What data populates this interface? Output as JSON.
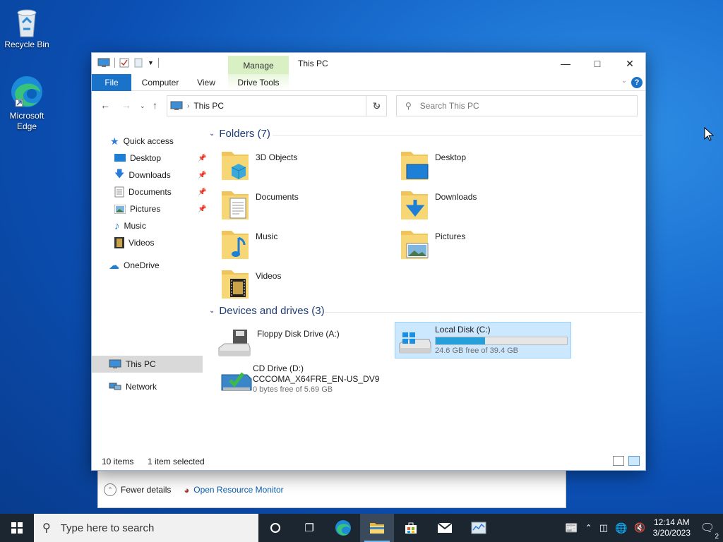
{
  "desktop": {
    "icons": [
      {
        "label": "Recycle Bin"
      },
      {
        "label": "Microsoft Edge"
      }
    ]
  },
  "background_window": {
    "fewer_details": "Fewer details",
    "open_resource_monitor": "Open Resource Monitor"
  },
  "explorer": {
    "title": "This PC",
    "context_tab": "Manage",
    "ribbon_tabs": [
      "File",
      "Computer",
      "View",
      "Drive Tools"
    ],
    "address": "This PC",
    "search_placeholder": "Search This PC",
    "nav": {
      "quick_access": "Quick access",
      "quick_items": [
        "Desktop",
        "Downloads",
        "Documents",
        "Pictures",
        "Music",
        "Videos"
      ],
      "onedrive": "OneDrive",
      "this_pc": "This PC",
      "network": "Network"
    },
    "folders_header": "Folders (7)",
    "folders": [
      "3D Objects",
      "Desktop",
      "Documents",
      "Downloads",
      "Music",
      "Pictures",
      "Videos"
    ],
    "devices_header": "Devices and drives (3)",
    "drives": {
      "floppy": {
        "name": "Floppy Disk Drive (A:)"
      },
      "local": {
        "name": "Local Disk (C:)",
        "free": "24.6 GB free of 39.4 GB",
        "used_fraction": 0.376
      },
      "cd": {
        "name": "CD Drive (D:)",
        "label": "CCCOMA_X64FRE_EN-US_DV9",
        "free": "0 bytes free of 5.69 GB"
      }
    },
    "status_items": "10 items",
    "status_selected": "1 item selected"
  },
  "taskbar": {
    "search_placeholder": "Type here to search",
    "time": "12:14 AM",
    "date": "3/20/2023",
    "notifications": "2"
  },
  "colors": {
    "accent": "#1a73c8",
    "taskbar": "#1b2631",
    "selection": "#cce8ff"
  }
}
